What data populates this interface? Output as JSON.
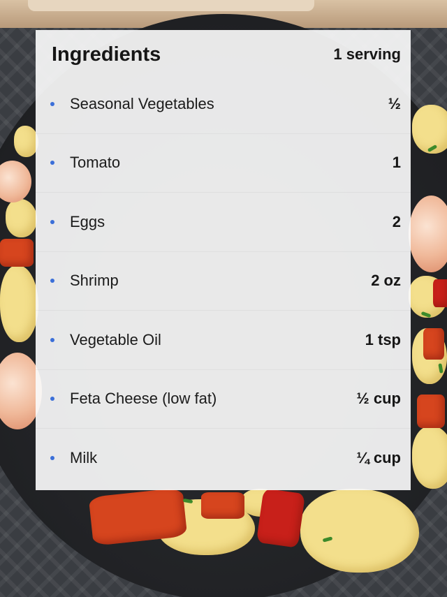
{
  "card": {
    "title": "Ingredients",
    "serving": "1 serving"
  },
  "ingredients": [
    {
      "name": "Seasonal Vegetables",
      "qty": "½"
    },
    {
      "name": "Tomato",
      "qty": "1"
    },
    {
      "name": "Eggs",
      "qty": "2"
    },
    {
      "name": "Shrimp",
      "qty": "2 oz"
    },
    {
      "name": "Vegetable Oil",
      "qty": "1 tsp"
    },
    {
      "name": "Feta Cheese (low fat)",
      "qty": "½ cup"
    },
    {
      "name": "Milk",
      "qty": "¼ cup"
    }
  ],
  "colors": {
    "bullet": "#3b6fd8",
    "card": "#fafafa",
    "egg": "#f3df8c",
    "pepper": "#d6451e",
    "pan": "#1f2023"
  }
}
